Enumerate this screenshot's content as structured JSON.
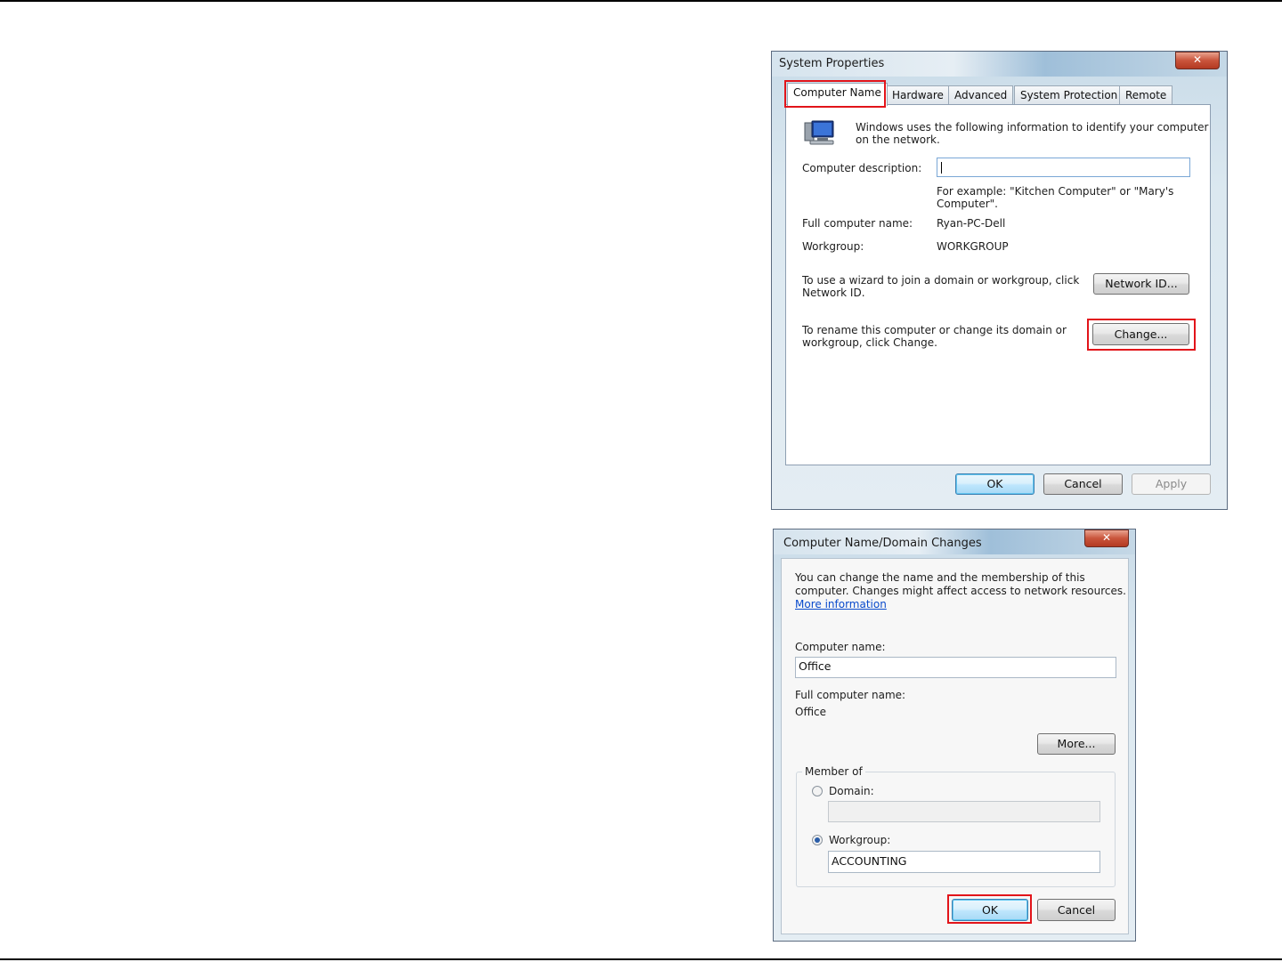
{
  "system_properties": {
    "title": "System Properties",
    "close_glyph": "✕",
    "tabs": [
      {
        "label": "Computer Name",
        "active": true
      },
      {
        "label": "Hardware",
        "active": false
      },
      {
        "label": "Advanced",
        "active": false
      },
      {
        "label": "System Protection",
        "active": false
      },
      {
        "label": "Remote",
        "active": false
      }
    ],
    "intro_line1": "Windows uses the following information to identify your computer",
    "intro_line2": "on the network.",
    "description_label": "Computer description:",
    "description_value": "",
    "example_line1": "For example: \"Kitchen Computer\" or \"Mary's",
    "example_line2": "Computer\".",
    "full_name_label": "Full computer name:",
    "full_name_value": "Ryan-PC-Dell",
    "workgroup_label": "Workgroup:",
    "workgroup_value": "WORKGROUP",
    "wizard_line1": "To use a wizard to join a domain or workgroup, click",
    "wizard_line2": "Network ID.",
    "network_id_button": "Network ID...",
    "rename_line1": "To rename this computer or change its domain or",
    "rename_line2": "workgroup, click Change.",
    "change_button": "Change...",
    "ok_button": "OK",
    "cancel_button": "Cancel",
    "apply_button": "Apply",
    "icon": "computer-network-icon"
  },
  "domain_changes": {
    "title": "Computer Name/Domain Changes",
    "close_glyph": "✕",
    "intro_line1": "You can change the name and the membership of this",
    "intro_line2": "computer. Changes might affect access to network resources.",
    "more_info_link": "More information",
    "computer_name_label": "Computer name:",
    "computer_name_value": "Office",
    "full_name_label": "Full computer name:",
    "full_name_value": "Office",
    "more_button": "More...",
    "member_of_label": "Member of",
    "domain_label": "Domain:",
    "domain_value": "",
    "domain_selected": false,
    "workgroup_label": "Workgroup:",
    "workgroup_value": "ACCOUNTING",
    "workgroup_selected": true,
    "ok_button": "OK",
    "cancel_button": "Cancel"
  },
  "colors": {
    "highlight": "#e2141a",
    "link": "#0a4bcc",
    "accent": "#3c7fb1"
  }
}
